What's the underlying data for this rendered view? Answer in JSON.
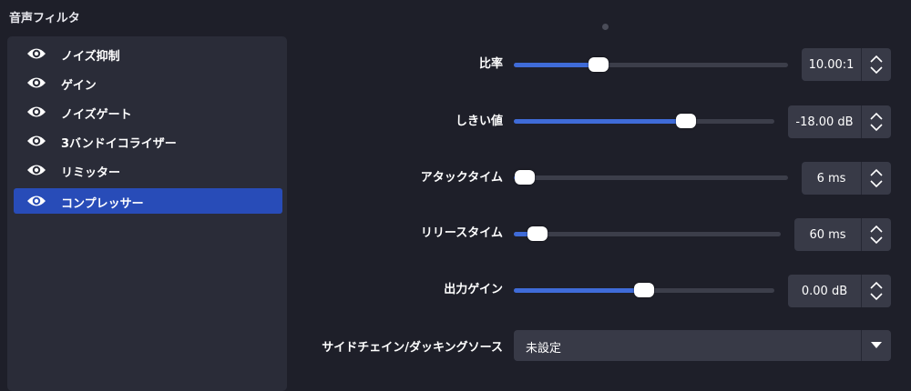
{
  "panel": {
    "title": "音声フィルタ"
  },
  "filters": [
    {
      "label": "ノイズ抑制",
      "icon": "eye-icon",
      "selected": false
    },
    {
      "label": "ゲイン",
      "icon": "eye-icon",
      "selected": false
    },
    {
      "label": "ノイズゲート",
      "icon": "eye-icon",
      "selected": false
    },
    {
      "label": "3バンドイコライザー",
      "icon": "eye-icon",
      "selected": false
    },
    {
      "label": "リミッター",
      "icon": "eye-icon",
      "selected": false
    },
    {
      "label": "コンプレッサー",
      "icon": "eye-icon",
      "selected": true
    }
  ],
  "settings": {
    "ratio": {
      "label": "比率",
      "value": "10.00:1",
      "level": 0.31
    },
    "threshold": {
      "label": "しきい値",
      "value": "-18.00 dB",
      "level": 0.66
    },
    "attack": {
      "label": "アタックタイム",
      "value": "6 ms",
      "level": 0.04
    },
    "release": {
      "label": "リリースタイム",
      "value": "60 ms",
      "level": 0.09
    },
    "output_gain": {
      "label": "出力ゲイン",
      "value": "0.00 dB",
      "level": 0.5
    },
    "sidechain": {
      "label": "サイドチェイン/ダッキングソース",
      "value": "未設定"
    }
  },
  "colors": {
    "background": "#1e1f29",
    "panel": "#2a2c38",
    "accent": "#284cb8",
    "slider_fill": "#3f6bd8"
  }
}
